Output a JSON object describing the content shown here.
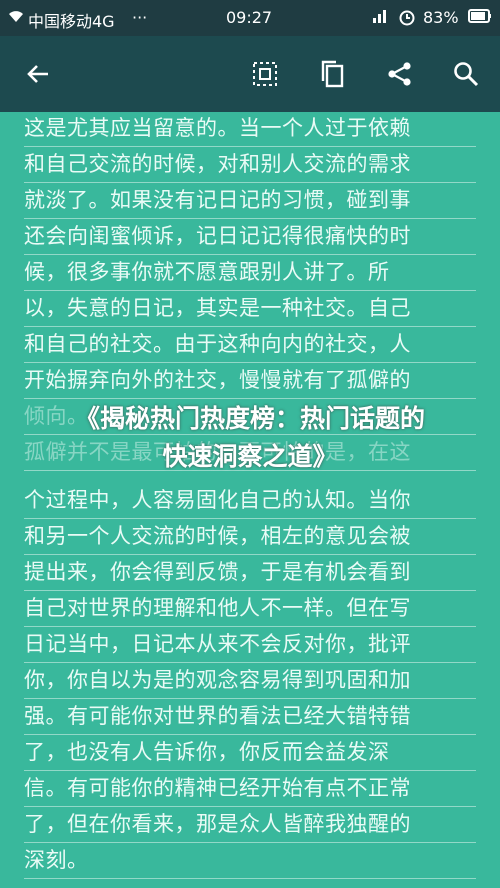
{
  "status_bar": {
    "carrier": "中国移动4G",
    "dots": "···",
    "time": "09:27",
    "battery": "83%"
  },
  "toolbar": {
    "back_icon": "arrow-left-icon",
    "icons": [
      "select-all-icon",
      "copy-icon",
      "share-icon",
      "search-icon"
    ]
  },
  "content": {
    "lines": [
      "这是尤其应当留意的。当一个人过于依赖",
      "和自己交流的时候，对和别人交流的需求",
      "就淡了。如果没有记日记的习惯，碰到事",
      "还会向闺蜜倾诉，记日记记得很痛快的时",
      "候，很多事你就不愿意跟别人讲了。所",
      "以，失意的日记，其实是一种社交。自己",
      "和自己的社交。由于这种向内的社交，人",
      "开始摒弃向外的社交，慢慢就有了孤僻的",
      "倾向。",
      "孤僻并不是最可怕的，更可怕的是，在这",
      "个过程中，人容易固化自己的认知。当你",
      "和另一个人交流的时候，相左的意见会被",
      "提出来，你会得到反馈，于是有机会看到",
      "自己对世界的理解和他人不一样。但在写",
      "日记当中，日记本从来不会反对你，批评",
      "你，你自以为是的观念容易得到巩固和加",
      "强。有可能你对世界的看法已经大错特错",
      "了，也没有人告诉你，你反而会益发深",
      "信。有可能你的精神已经开始有点不正常",
      "了，但在你看来，那是众人皆醉我独醒的",
      "深刻。"
    ],
    "overlay_title_line1": "《揭秘热门热度榜：热门话题的",
    "overlay_title_line2": "快速洞察之道》"
  },
  "colors": {
    "status_bg": "#1f3c42",
    "toolbar_bg": "#1d4a4f",
    "page_bg": "#39b89c",
    "text": "#e9fbf6"
  }
}
